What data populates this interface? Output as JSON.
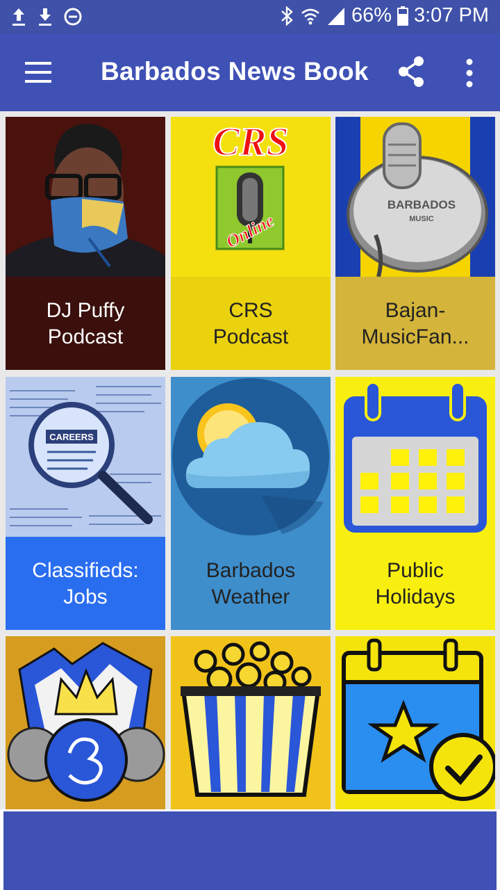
{
  "status_bar": {
    "battery": "66%",
    "time": "3:07 PM",
    "icons": [
      "upload-icon",
      "download-icon",
      "do-not-disturb-icon",
      "bluetooth-icon",
      "wifi-icon",
      "signal-icon",
      "battery-icon"
    ]
  },
  "app_bar": {
    "title": "Barbados News Book",
    "icons": [
      "menu-icon",
      "share-icon",
      "more-vert-icon"
    ]
  },
  "tiles": [
    {
      "label": "DJ Puffy\nPodcast",
      "label_bg": "#3a0f0c",
      "label_color": "#ffffff",
      "art_text": ""
    },
    {
      "label": "CRS\nPodcast",
      "label_bg": "#ead20e",
      "label_color": "#222222",
      "art_text": "CRS",
      "art_sub": "Online"
    },
    {
      "label": "Bajan-\nMusicFan...",
      "label_bg": "#d4b43a",
      "label_color": "#222222",
      "art_text": "BARBADOS",
      "art_sub": "MUSIC"
    },
    {
      "label": "Classifieds:\nJobs",
      "label_bg": "#2a6ef0",
      "label_color": "#ffffff",
      "art_text": "CAREERS"
    },
    {
      "label": "Barbados\nWeather",
      "label_bg": "#3f8ecc",
      "label_color": "#222222"
    },
    {
      "label": "Public\nHolidays",
      "label_bg": "#f8ef10",
      "label_color": "#222222"
    },
    {
      "label": "",
      "label_bg": "#d59c20"
    },
    {
      "label": "",
      "label_bg": "#f1c21a"
    },
    {
      "label": "",
      "label_bg": "#f5e30c"
    }
  ],
  "colors": {
    "primary": "#3f51b5",
    "status_bar": "#3f51a8"
  }
}
